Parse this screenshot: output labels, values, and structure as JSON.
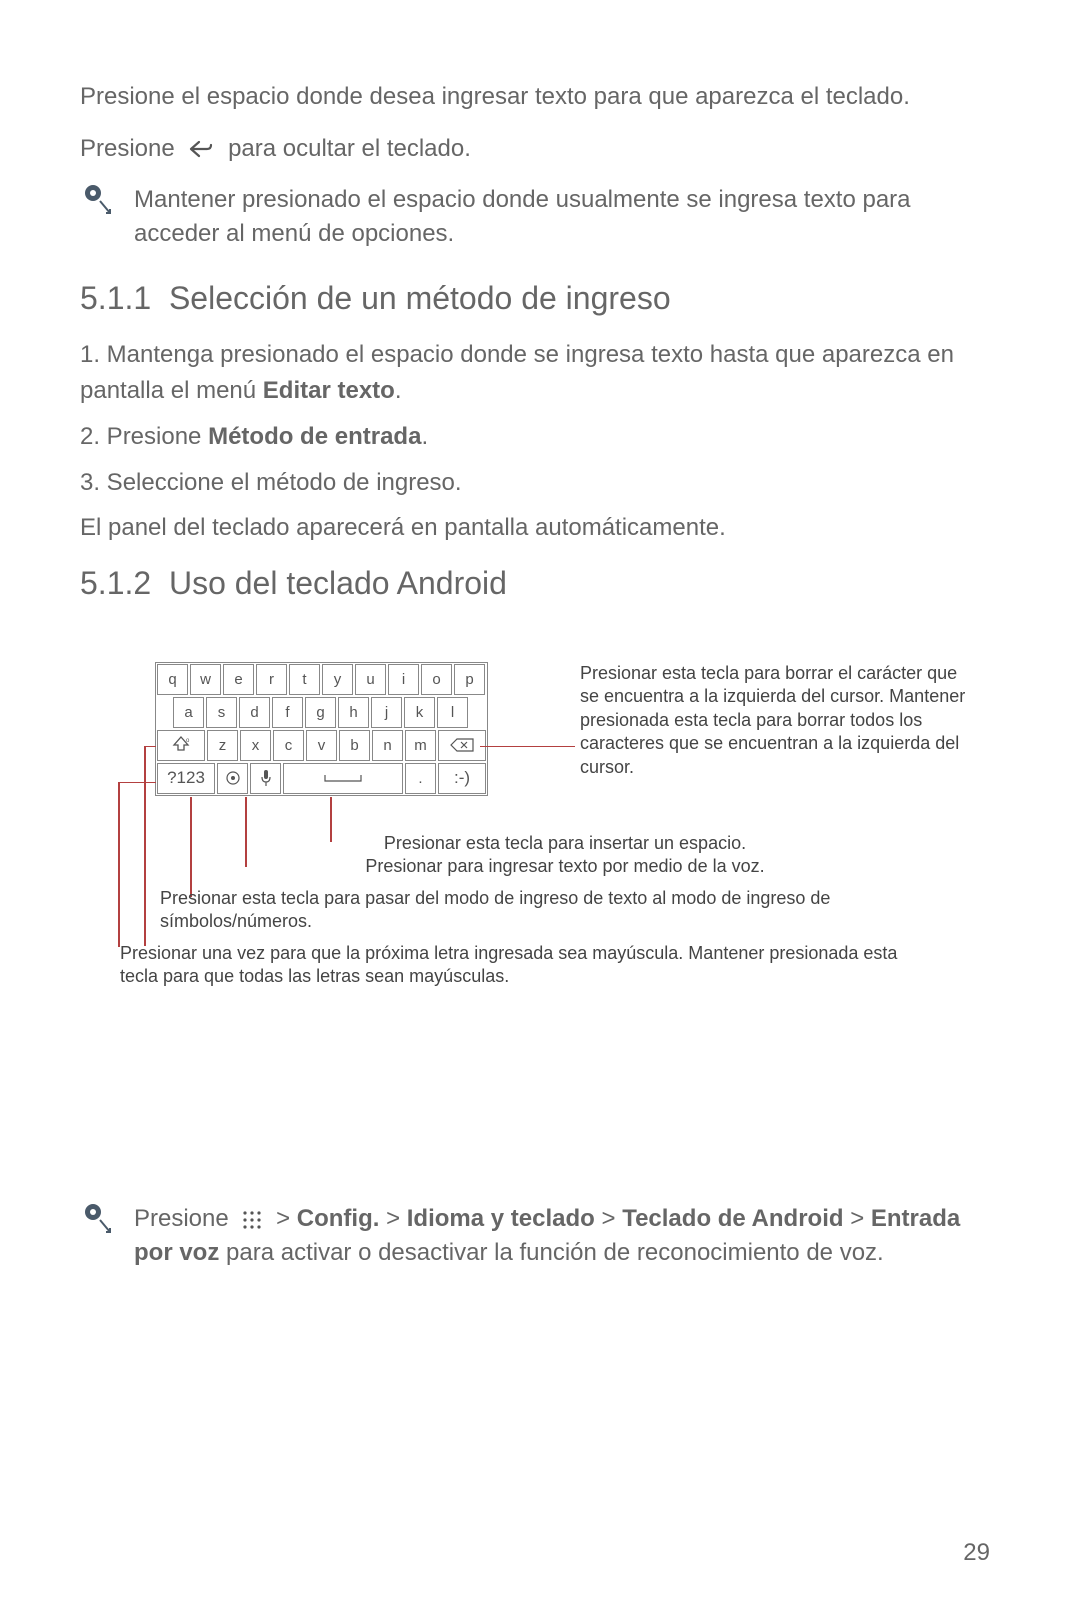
{
  "intro": {
    "p1": "Presione el espacio donde desea ingresar texto para que aparezca el teclado.",
    "p2_before": "Presione",
    "p2_after": "para ocultar el teclado."
  },
  "tip1": "Mantener presionado el espacio donde usualmente se ingresa texto para acceder al menú de opciones.",
  "section_511": {
    "num": "5.1.1",
    "title": "Selección de un método de ingreso",
    "step1_a": "1. Mantenga presionado el espacio donde se ingresa texto hasta que aparezca en pantalla el menú ",
    "step1_b": "Editar texto",
    "step1_c": ".",
    "step2_a": "2. Presione ",
    "step2_b": "Método de entrada",
    "step2_c": ".",
    "step3": "3. Seleccione el método de ingreso.",
    "note": "El panel del teclado aparecerá en pantalla automáticamente."
  },
  "section_512": {
    "num": "5.1.2",
    "title": "Uso del teclado Android"
  },
  "keyboard": {
    "row1": [
      "q",
      "w",
      "e",
      "r",
      "t",
      "y",
      "u",
      "i",
      "o",
      "p"
    ],
    "row2": [
      "a",
      "s",
      "d",
      "f",
      "g",
      "h",
      "j",
      "k",
      "l"
    ],
    "row3": [
      "z",
      "x",
      "c",
      "v",
      "b",
      "n",
      "m"
    ],
    "sym": "?123",
    "period": ".",
    "smile": ":-)"
  },
  "callouts": {
    "right": "Presionar esta tecla para borrar el carácter que se encuentra a la izquierda del cursor. Mantener presionada esta tecla para borrar todos los caracteres que se encuentran a la izquierda del cursor.",
    "mid1a": "Presionar esta tecla para insertar un espacio.",
    "mid1b": "Presionar para ingresar texto por medio de la voz.",
    "mid2": "Presionar esta tecla para pasar del modo de ingreso de texto al modo de ingreso de símbolos/números.",
    "bot": "Presionar una vez para que la próxima letra ingresada sea mayúscula. Mantener presionada esta tecla para que todas las letras sean mayúsculas."
  },
  "tip2": {
    "a": "Presione",
    "b": "Config.",
    "c": "Idioma y teclado",
    "d": "Teclado de Android",
    "e": "Entrada por voz",
    "f": " para activar o desactivar la función de reconocimiento de voz."
  },
  "page": "29"
}
